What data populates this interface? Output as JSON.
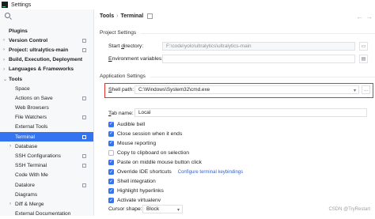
{
  "window": {
    "title": "Settings"
  },
  "sidebar": {
    "items": [
      {
        "label": "Plugins",
        "level": 0,
        "bold": true,
        "arrow": "",
        "gear": false,
        "selected": false
      },
      {
        "label": "Version Control",
        "level": 0,
        "bold": true,
        "arrow": "›",
        "gear": true,
        "selected": false
      },
      {
        "label": "Project: ultralytics-main",
        "level": 0,
        "bold": true,
        "arrow": "›",
        "gear": true,
        "selected": false
      },
      {
        "label": "Build, Execution, Deployment",
        "level": 0,
        "bold": true,
        "arrow": "›",
        "gear": false,
        "selected": false
      },
      {
        "label": "Languages & Frameworks",
        "level": 0,
        "bold": true,
        "arrow": "›",
        "gear": false,
        "selected": false
      },
      {
        "label": "Tools",
        "level": 0,
        "bold": true,
        "arrow": "⌄",
        "gear": false,
        "selected": false
      },
      {
        "label": "Space",
        "level": 1,
        "bold": false,
        "arrow": "",
        "gear": false,
        "selected": false
      },
      {
        "label": "Actions on Save",
        "level": 1,
        "bold": false,
        "arrow": "",
        "gear": true,
        "selected": false
      },
      {
        "label": "Web Browsers",
        "level": 1,
        "bold": false,
        "arrow": "",
        "gear": false,
        "selected": false
      },
      {
        "label": "File Watchers",
        "level": 1,
        "bold": false,
        "arrow": "",
        "gear": true,
        "selected": false
      },
      {
        "label": "External Tools",
        "level": 1,
        "bold": false,
        "arrow": "",
        "gear": false,
        "selected": false
      },
      {
        "label": "Terminal",
        "level": 1,
        "bold": false,
        "arrow": "",
        "gear": true,
        "selected": true
      },
      {
        "label": "Database",
        "level": 1,
        "bold": false,
        "arrow": "›",
        "gear": false,
        "selected": false
      },
      {
        "label": "SSH Configurations",
        "level": 1,
        "bold": false,
        "arrow": "",
        "gear": true,
        "selected": false
      },
      {
        "label": "SSH Terminal",
        "level": 1,
        "bold": false,
        "arrow": "",
        "gear": true,
        "selected": false
      },
      {
        "label": "Code With Me",
        "level": 1,
        "bold": false,
        "arrow": "",
        "gear": false,
        "selected": false
      },
      {
        "label": "Datalore",
        "level": 1,
        "bold": false,
        "arrow": "",
        "gear": true,
        "selected": false
      },
      {
        "label": "Diagrams",
        "level": 1,
        "bold": false,
        "arrow": "",
        "gear": false,
        "selected": false
      },
      {
        "label": "Diff & Merge",
        "level": 1,
        "bold": false,
        "arrow": "›",
        "gear": false,
        "selected": false
      },
      {
        "label": "External Documentation",
        "level": 1,
        "bold": false,
        "arrow": "",
        "gear": false,
        "selected": false
      }
    ]
  },
  "breadcrumb": {
    "parent": "Tools",
    "separator": "›",
    "current": "Terminal"
  },
  "project_settings": {
    "header": "Project Settings",
    "start_dir_label_pre": "Start ",
    "start_dir_label_mn": "d",
    "start_dir_label_post": "irectory:",
    "start_dir_value": "F:\\code\\yolo\\ultralytics\\ultralytics-main",
    "env_label_pre": "",
    "env_label_mn": "E",
    "env_label_post": "nvironment variables:",
    "env_value": ""
  },
  "app_settings": {
    "header": "Application Settings",
    "shell_label_pre": "",
    "shell_label_mn": "S",
    "shell_label_post": "hell path:",
    "shell_value": "C:\\Windows\\System32\\cmd.exe",
    "browse_label": "...",
    "tab_label_pre": "",
    "tab_label_mn": "T",
    "tab_label_post": "ab name:",
    "tab_value": "Local"
  },
  "checkboxes": [
    {
      "label": "Audible bell",
      "checked": true,
      "link": ""
    },
    {
      "label": "Close session when it ends",
      "checked": true,
      "link": ""
    },
    {
      "label": "Mouse reporting",
      "checked": true,
      "link": ""
    },
    {
      "label": "Copy to clipboard on selection",
      "checked": false,
      "link": ""
    },
    {
      "label": "Paste on middle mouse button click",
      "checked": true,
      "link": ""
    },
    {
      "label": "Override IDE shortcuts",
      "checked": true,
      "link": "Configure terminal keybindings"
    },
    {
      "label": "Shell integration",
      "checked": true,
      "link": ""
    },
    {
      "label": "Highlight hyperlinks",
      "checked": true,
      "link": ""
    },
    {
      "label": "Activate virtualenv",
      "checked": true,
      "link": ""
    }
  ],
  "cursor": {
    "label": "Cursor shape:",
    "value": "Block"
  },
  "watermark": "CSDN @TryRestart",
  "colors": {
    "accent": "#3574f0",
    "highlight_outline": "#e0362c",
    "link": "#2f5fd0"
  }
}
